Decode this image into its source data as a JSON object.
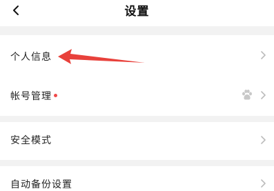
{
  "header": {
    "title": "设置",
    "back_icon": "chevron-left-icon"
  },
  "settings": {
    "items": [
      {
        "label": "个人信息",
        "icon": "chevron-right-icon"
      },
      {
        "label": "帐号管理",
        "badge": "red-dot",
        "extra_icon": "paw-icon",
        "icon": "chevron-right-icon"
      },
      {
        "label": "安全模式",
        "icon": "chevron-right-icon"
      },
      {
        "label": "自动备份设置",
        "icon": "chevron-right-icon"
      }
    ]
  },
  "annotation": {
    "arrow_color": "#e8413b",
    "points_to": "个人信息"
  },
  "colors": {
    "background": "#f2f2f2",
    "text": "#222222",
    "chevron": "#bbbbbb",
    "badge": "#f04a4a"
  }
}
